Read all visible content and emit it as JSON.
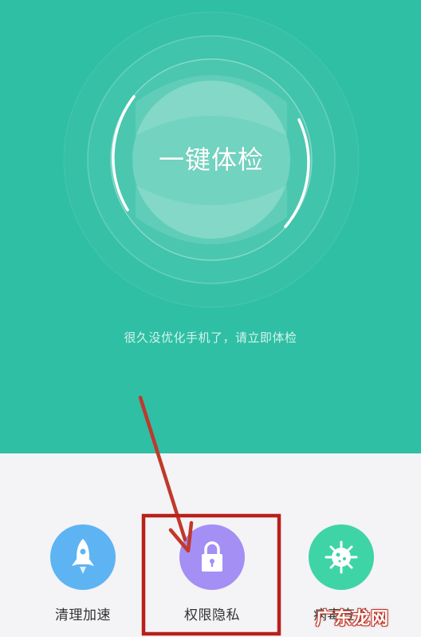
{
  "main": {
    "scan_button_label": "一键体检",
    "hint": "很久没优化手机了，请立即体检"
  },
  "tools": [
    {
      "label": "清理加速",
      "icon": "rocket-icon",
      "color": "#5eb4f3"
    },
    {
      "label": "权限隐私",
      "icon": "lock-icon",
      "color": "#a48ff5"
    },
    {
      "label": "病毒查杀",
      "icon": "virus-icon",
      "color": "#3fd4a6"
    }
  ],
  "colors": {
    "header_bg": "#2ebfa4",
    "annotation": "#c0392b"
  },
  "watermark": "广东龙网"
}
